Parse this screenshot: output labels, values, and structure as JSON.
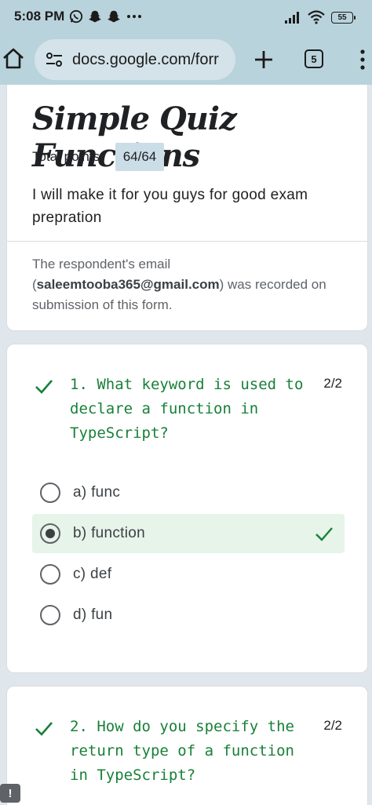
{
  "status_bar": {
    "time": "5:08 PM",
    "left_icons": [
      "whatsapp-icon",
      "snapchat-icon",
      "snapchat-icon",
      "more-dots-icon"
    ],
    "right_icons": [
      "signal-icon",
      "wifi-icon"
    ],
    "battery": "55"
  },
  "browser": {
    "url": "docs.google.com/forr",
    "tab_count": "5"
  },
  "form": {
    "title": "Simple Quiz Functions",
    "points_label": "Total points",
    "points_value": "64/64",
    "description": "I will make it for you guys  for good exam prepration",
    "email_prefix": "The respondent's email (",
    "email": "saleemtooba365@gmail.com",
    "email_suffix": ") was recorded on submission of this form."
  },
  "questions": [
    {
      "text": "1. What keyword is used to declare a function in TypeScript?",
      "score": "2/2",
      "options": [
        "a) func",
        "b) function",
        "c) def",
        "d) fun"
      ],
      "selected_index": 1
    },
    {
      "text": "2. How do you specify the return type of a function in TypeScript?",
      "score": "2/2"
    }
  ],
  "colors": {
    "correct_green": "#188038",
    "selected_bg": "#e6f4ea",
    "bar_bg": "#b9d3dc"
  }
}
